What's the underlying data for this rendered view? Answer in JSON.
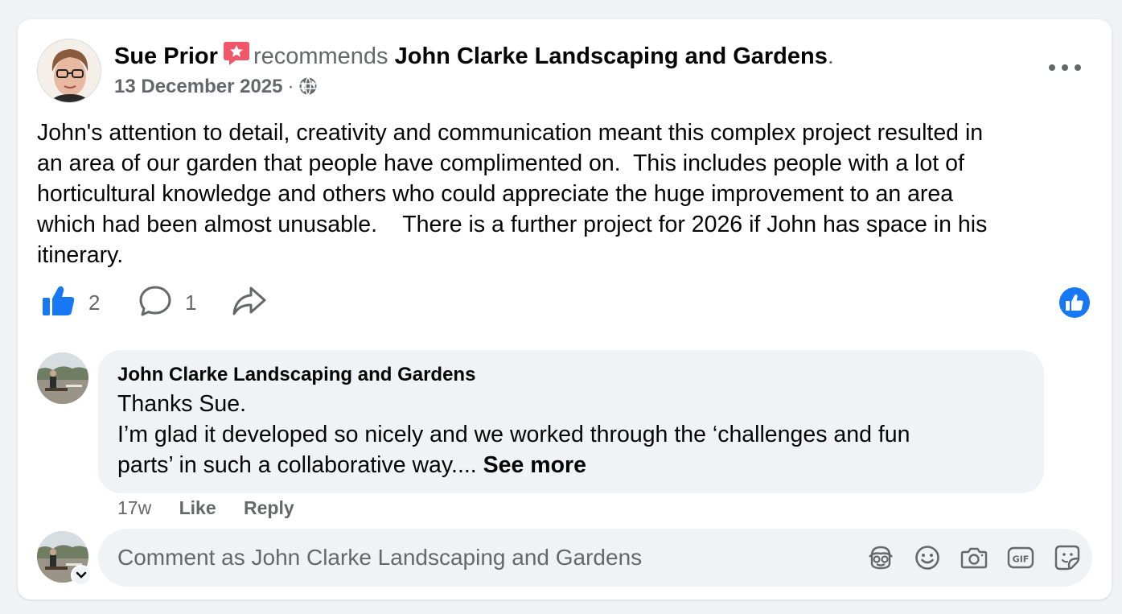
{
  "post": {
    "author": "Sue Prior",
    "verb": "recommends",
    "page": "John Clarke Landscaping and Gardens",
    "period": ".",
    "date": "13 December 2025",
    "separator": "·",
    "text": "John's attention to detail, creativity and communication meant this complex project resulted in\nan area of our garden that people have complimented on.  This includes people with a lot of\nhorticultural knowledge and others who could appreciate the huge improvement to an area\nwhich had been almost unusable.    There is a further project for 2026 if John has space in his\nitinerary.",
    "like_count": "2",
    "comment_count": "1"
  },
  "comment": {
    "author": "John Clarke Landscaping and Gardens",
    "text": "Thanks Sue.\nI’m glad it developed so nicely and we worked through the ‘challenges and fun\nparts’ in such a collaborative way.... ",
    "see_more": "See more",
    "time": "17w",
    "like_label": "Like",
    "reply_label": "Reply"
  },
  "composer": {
    "placeholder": "Comment as John Clarke Landscaping and Gardens"
  },
  "colors": {
    "accent": "#1877f2",
    "recommend_badge": "#f0586a",
    "secondary_text": "#65676b",
    "background": "#f0f2f5"
  },
  "icons": [
    "recommend-star-icon",
    "globe-icon",
    "more-options-icon",
    "like-thumb-icon",
    "comment-bubble-icon",
    "share-arrow-icon",
    "like-reaction-icon",
    "chevron-down-icon",
    "avatar-sticker-icon",
    "emoji-icon",
    "camera-icon",
    "gif-icon",
    "sticker-icon"
  ]
}
